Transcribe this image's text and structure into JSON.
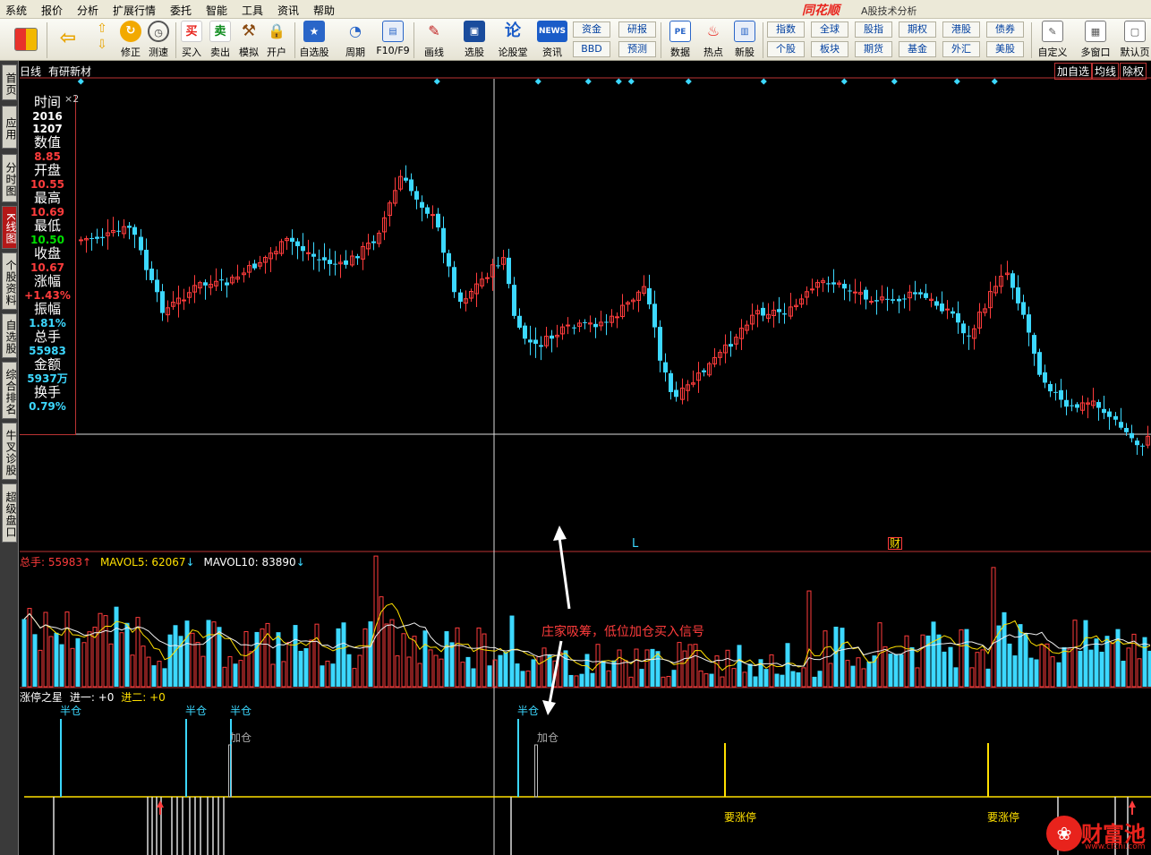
{
  "menubar": {
    "items": [
      "系统",
      "报价",
      "分析",
      "扩展行情",
      "委托",
      "智能",
      "工具",
      "资讯",
      "帮助"
    ],
    "logo": "同花顺",
    "subtitle": "A股技术分析"
  },
  "toolbar": {
    "buttons": [
      "修正",
      "测速",
      "买入",
      "卖出",
      "模拟",
      "开户",
      "自选股",
      "周期",
      "F10/F9",
      "画线",
      "选股",
      "论股堂",
      "资讯",
      "数据",
      "热点",
      "新股",
      "自定义",
      "多窗口",
      "默认页"
    ],
    "buy_glyph": "买",
    "sell_glyph": "卖",
    "news_glyph": "NEWS",
    "lun_glyph": "论",
    "grid_buttons": [
      "资金",
      "研报",
      "BBD",
      "预测",
      "指数",
      "全球",
      "股指",
      "期权",
      "港股",
      "债券",
      "个股",
      "板块",
      "期货",
      "基金",
      "外汇",
      "美股"
    ]
  },
  "left_tabs": [
    "首页",
    "应用",
    "分时图",
    "K线图",
    "个股资料",
    "自选股",
    "综合排名",
    "牛叉诊股",
    "超级盘口"
  ],
  "chart_header": {
    "period": "日线",
    "stock_name": "有研新材",
    "actions": [
      "加自选",
      "均线",
      "除权"
    ]
  },
  "info_panel": {
    "close_mark": "×2",
    "time_label": "时间",
    "year": "2016",
    "date": "1207",
    "value_label": "数值",
    "value": "8.85",
    "open_label": "开盘",
    "open": "10.55",
    "high_label": "最高",
    "high": "10.69",
    "low_label": "最低",
    "low": "10.50",
    "close_label": "收盘",
    "close": "10.67",
    "change_label": "涨幅",
    "change": "+1.43%",
    "amplitude_label": "振幅",
    "amplitude": "1.81%",
    "volume_label": "总手",
    "volume": "55983",
    "amount_label": "金额",
    "amount": "5937万",
    "turnover_label": "换手",
    "turnover": "0.79%"
  },
  "volume_header": {
    "total_label": "总手: ",
    "total": "55983",
    "mavol5_label": "MAVOL5: ",
    "mavol5": "62067",
    "mavol10_label": "MAVOL10: ",
    "mavol10": "83890"
  },
  "indicator_header": {
    "name": "涨停之星",
    "jin1": "进一: +0",
    "jin2": "进二: +0"
  },
  "markers": {
    "L": "L",
    "cai": "财"
  },
  "signals": {
    "half": "半仓",
    "add": "加仓",
    "limit_up": "要涨停"
  },
  "annotation": "庄家吸筹，低位加仓买入信号",
  "watermark": {
    "brand": "财富池",
    "url": "www.cfchi.com"
  },
  "colors": {
    "up": "#ff3c3c",
    "down": "#3cd8ff",
    "signal": "#ffe000",
    "background": "#000000"
  }
}
